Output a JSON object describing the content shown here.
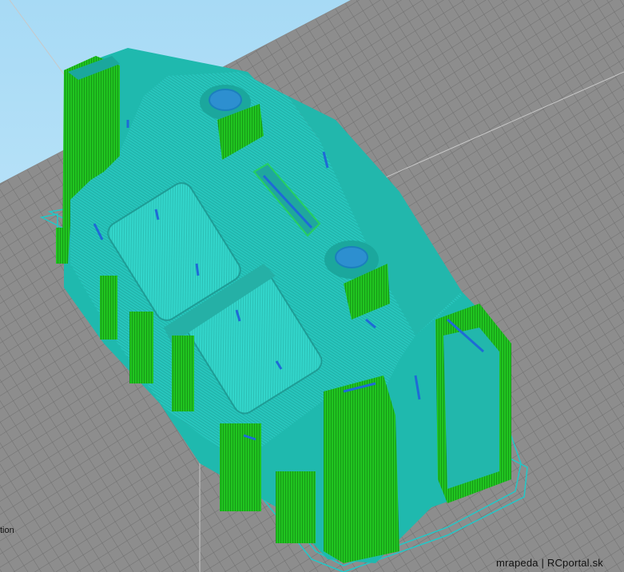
{
  "viewport": {
    "side_label": "tion",
    "watermark": "mrapeda | RCportal.sk"
  },
  "colors": {
    "background_top": "#a9dcf6",
    "background_bottom": "#cfeefe",
    "build_plate": "#8c8c8c",
    "grid_line": "#6e6e6e",
    "perimeter": "#1ec41e",
    "infill": "#28c9be",
    "top_skin": "#33dccf",
    "support": "#1e6bd6",
    "skirt": "#22c8c8"
  }
}
